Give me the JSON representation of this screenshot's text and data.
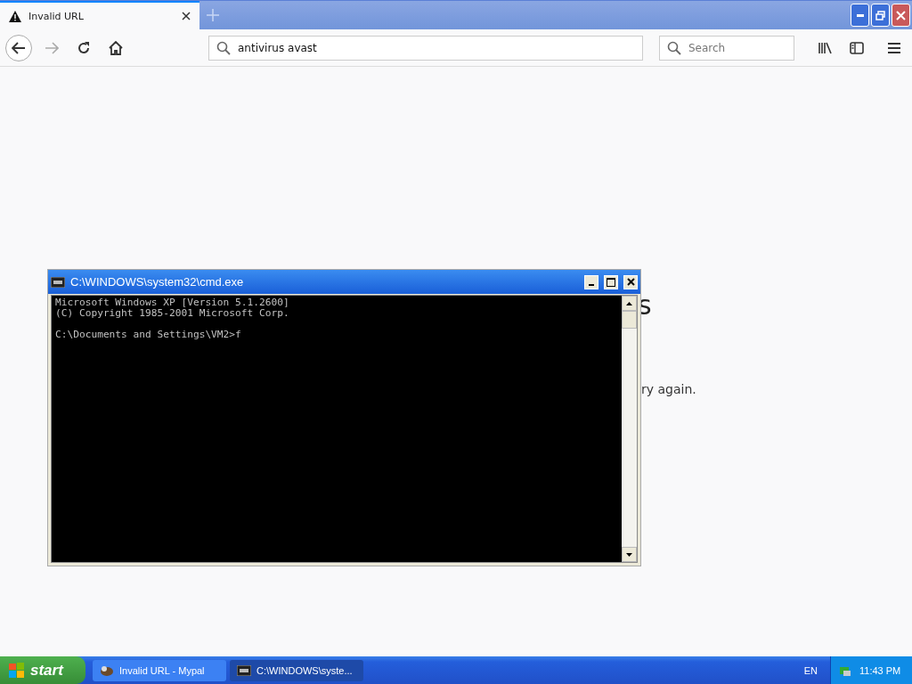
{
  "browser": {
    "tabs": [
      {
        "title": "Invalid URL",
        "selected": true
      }
    ],
    "address": {
      "value": "antivirus avast"
    },
    "search": {
      "placeholder": "Search"
    },
    "page": {
      "heading_visible": "s",
      "text_visible": "ry again."
    }
  },
  "console_window": {
    "title": "C:\\WINDOWS\\system32\\cmd.exe",
    "blocks": [
      [
        "Microsoft Windows XP [Version 5.1.2600]",
        "(C) Copyright 1985-2001 Microsoft Corp."
      ],
      [
        "C:\\Documents and Settings\\VM2>f"
      ]
    ]
  },
  "taskbar": {
    "start": "start",
    "items": [
      {
        "label": "Invalid URL - Mypal",
        "kind": "browser",
        "selected": false
      },
      {
        "label": "C:\\WINDOWS\\syste...",
        "kind": "console",
        "selected": true
      }
    ],
    "language": "EN",
    "clock": "11:43 PM"
  }
}
